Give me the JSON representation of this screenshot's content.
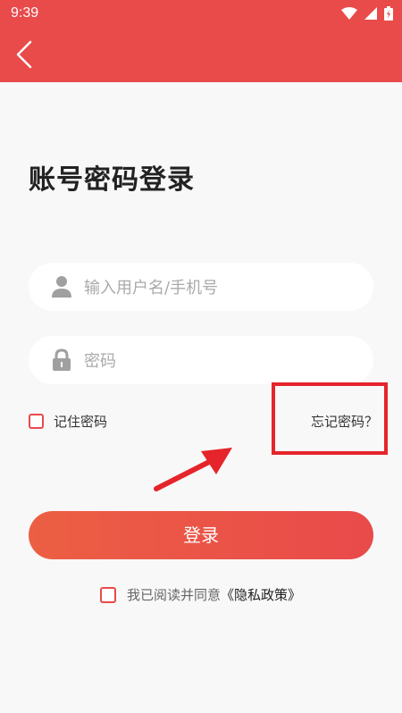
{
  "status_bar": {
    "time": "9:39"
  },
  "page": {
    "title": "账号密码登录"
  },
  "form": {
    "username_placeholder": "输入用户名/手机号",
    "password_placeholder": "密码",
    "remember_label": "记住密码",
    "forgot_label": "忘记密码？",
    "login_label": "登录"
  },
  "agreement": {
    "prefix": "我已阅读并同意",
    "policy_link": "《隐私政策》"
  },
  "colors": {
    "primary": "#e94a4a",
    "highlight": "#e5242b"
  },
  "icons": [
    "back-arrow-icon",
    "user-icon",
    "lock-icon",
    "wifi-icon",
    "signal-icon",
    "battery-icon"
  ]
}
